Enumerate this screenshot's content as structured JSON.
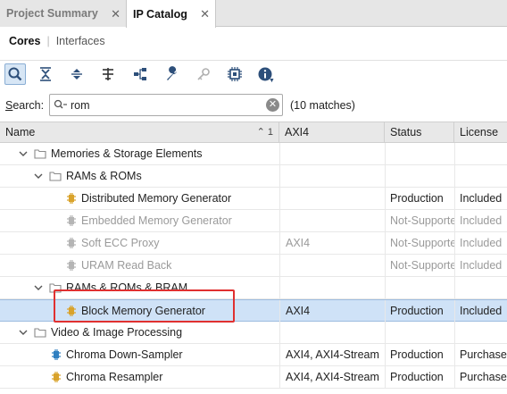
{
  "tabs": [
    {
      "label": "Project Summary",
      "active": false
    },
    {
      "label": "IP Catalog",
      "active": true
    }
  ],
  "subtabs": {
    "cores": "Cores",
    "separator": "|",
    "interfaces": "Interfaces"
  },
  "toolbar": [
    "search-icon",
    "collapse-all-icon",
    "expand-all-icon",
    "filter-icon",
    "hierarchy-icon",
    "wrench-icon",
    "key-icon",
    "chip-icon",
    "info-icon"
  ],
  "search": {
    "label_prefix": "S",
    "label_rest": "earch:",
    "value": "rom",
    "matches": "(10 matches)"
  },
  "columns": {
    "name": "Name",
    "sort": "1",
    "axi": "AXI4",
    "status": "Status",
    "license": "License"
  },
  "rows": [
    {
      "name": "Memories & Storage Elements",
      "axi": "",
      "status": "",
      "license": "",
      "kind": "folder",
      "level": 0,
      "disabled": false
    },
    {
      "name": "RAMs & ROMs",
      "axi": "",
      "status": "",
      "license": "",
      "kind": "folder",
      "level": 1,
      "disabled": false
    },
    {
      "name": "Distributed Memory Generator",
      "axi": "",
      "status": "Production",
      "license": "Included",
      "kind": "ip",
      "level": 2,
      "disabled": false
    },
    {
      "name": "Embedded Memory Generator",
      "axi": "",
      "status": "Not-Supported",
      "license": "Included",
      "kind": "ip",
      "level": 2,
      "disabled": true
    },
    {
      "name": "Soft ECC Proxy",
      "axi": "AXI4",
      "status": "Not-Supported",
      "license": "Included",
      "kind": "ip",
      "level": 2,
      "disabled": true
    },
    {
      "name": "URAM Read Back",
      "axi": "",
      "status": "Not-Supported",
      "license": "Included",
      "kind": "ip",
      "level": 2,
      "disabled": true
    },
    {
      "name": "RAMs & ROMs & BRAM",
      "axi": "",
      "status": "",
      "license": "",
      "kind": "folder",
      "level": 1,
      "disabled": false
    },
    {
      "name": "Block Memory Generator",
      "axi": "AXI4",
      "status": "Production",
      "license": "Included",
      "kind": "ip",
      "level": 2,
      "disabled": false,
      "selected": true
    },
    {
      "name": "Video & Image Processing",
      "axi": "",
      "status": "",
      "license": "",
      "kind": "folder",
      "level": 0,
      "disabled": false
    },
    {
      "name": "Chroma Down-Sampler",
      "axi": "AXI4, AXI4-Stream",
      "status": "Production",
      "license": "Purchase",
      "kind": "ip-blue",
      "level": 1,
      "disabled": false
    },
    {
      "name": "Chroma Resampler",
      "axi": "AXI4, AXI4-Stream",
      "status": "Production",
      "license": "Purchase",
      "kind": "ip",
      "level": 1,
      "disabled": false
    }
  ],
  "colors": {
    "selection": "#cfe2f7",
    "highlight": "#e03030",
    "ip_icon": "#d9a32c"
  }
}
